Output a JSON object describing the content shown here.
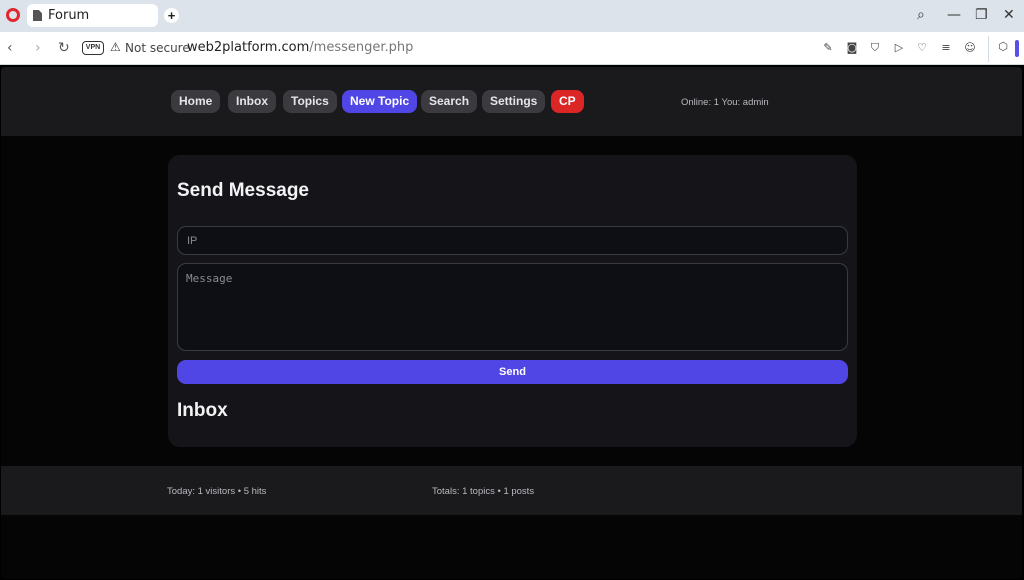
{
  "browser": {
    "tab_title": "Forum",
    "new_tab": "+",
    "not_secure": "Not secure",
    "vpn_label": "VPN",
    "url_host": "web2platform.com",
    "url_path": "/messenger.php"
  },
  "nav": {
    "items": [
      {
        "label": "Home"
      },
      {
        "label": "Inbox"
      },
      {
        "label": "Topics"
      },
      {
        "label": "New Topic"
      },
      {
        "label": "Search"
      },
      {
        "label": "Settings"
      },
      {
        "label": "CP"
      }
    ],
    "online_text": "Online: 1  You: admin"
  },
  "form": {
    "title": "Send Message",
    "ip_placeholder": "IP",
    "message_placeholder": "Message",
    "send_label": "Send"
  },
  "inbox": {
    "title": "Inbox"
  },
  "footer": {
    "today": "Today: 1 visitors • 5 hits",
    "totals": "Totals: 1 topics • 1 posts"
  },
  "colors": {
    "accent": "#4f46e5",
    "danger": "#dc2626",
    "surface": "#151519"
  }
}
